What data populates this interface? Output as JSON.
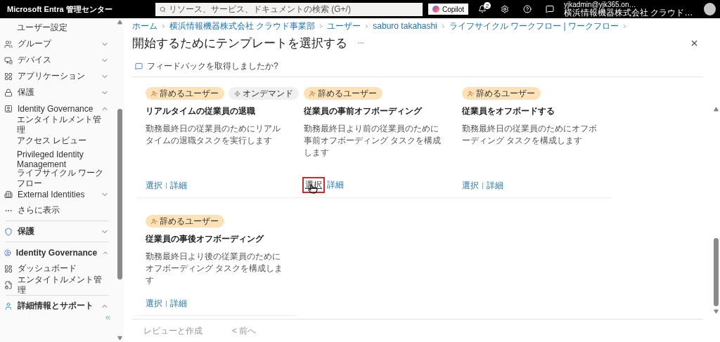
{
  "topbar": {
    "brand": "Microsoft Entra 管理センター",
    "search": {
      "placeholder": "リソース、サービス、ドキュメントの検索 (G+/)"
    },
    "copilot": "Copilot",
    "notifications": "2",
    "account": {
      "email": "yjkadmin@yjk365.on…",
      "org": "横浜情報機器株式会社 クラウド…"
    }
  },
  "sidebar": {
    "items": [
      {
        "label": "ユーザー設定",
        "kind": "sub"
      },
      {
        "label": "グループ",
        "kind": "nav",
        "expanded": false
      },
      {
        "label": "デバイス",
        "kind": "nav",
        "expanded": false
      },
      {
        "label": "アプリケーション",
        "kind": "nav",
        "expanded": false
      },
      {
        "label": "保護",
        "kind": "nav",
        "expanded": false
      },
      {
        "label": "Identity Governance",
        "kind": "nav",
        "expanded": true,
        "children": [
          {
            "label": "エンタイトルメント管理"
          },
          {
            "label": "アクセス レビュー"
          },
          {
            "label": "Privileged Identity Management"
          },
          {
            "label": "ライフサイクル ワークフロー"
          }
        ]
      },
      {
        "label": "External Identities",
        "kind": "nav",
        "expanded": false
      },
      {
        "label": "さらに表示",
        "kind": "more"
      },
      {
        "label": "保護",
        "kind": "section",
        "expanded": false
      },
      {
        "label": "Identity Governance",
        "kind": "section",
        "expanded": true,
        "children": [
          {
            "label": "ダッシュボード"
          },
          {
            "label": "エンタイトルメント管理"
          }
        ]
      },
      {
        "label": "詳細情報とサポート",
        "kind": "section",
        "expanded": true
      }
    ]
  },
  "breadcrumb": [
    "ホーム",
    "横浜情報機器株式会社 クラウド事業部",
    "ユーザー",
    "saburo takahashi",
    "ライフサイクル ワークフロー | ワークフロー"
  ],
  "title": "開始するためにテンプレートを選択する",
  "feedback": "フィードバックを取得しましたか?",
  "templates": [
    {
      "tags": [
        {
          "label": "辞めるユーザー",
          "kind": "trigger"
        },
        {
          "label": "オンデマンド",
          "kind": "mode"
        }
      ],
      "title": "リアルタイムの従業員の退職",
      "description": "勤務最終日の従業員のためにリアルタイムの退職タスクを実行します",
      "links": [
        "選択",
        "詳細"
      ],
      "highlighted": false
    },
    {
      "tags": [
        {
          "label": "辞めるユーザー",
          "kind": "trigger"
        }
      ],
      "title": "従業員の事前オフボーディング",
      "description": "勤務最終日より前の従業員のために事前オフボーディング タスクを構成します",
      "links": [
        "選択",
        "詳細"
      ],
      "highlighted": true
    },
    {
      "tags": [
        {
          "label": "辞めるユーザー",
          "kind": "trigger"
        }
      ],
      "title": "従業員をオフボードする",
      "description": "勤務最終日の従業員のためにオフボーディング タスクを構成します",
      "links": [
        "選択",
        "詳細"
      ],
      "highlighted": false
    },
    {
      "tags": [
        {
          "label": "辞めるユーザー",
          "kind": "trigger"
        }
      ],
      "title": "従業員の事後オフボーディング",
      "description": "勤務最終日より後の従業員のためにオフボーディング タスクを構成します",
      "links": [
        "選択",
        "詳細"
      ],
      "highlighted": false
    }
  ],
  "footer": [
    {
      "label": "レビューと作成",
      "disabled": true
    },
    {
      "label": "< 前へ",
      "disabled": true
    }
  ]
}
